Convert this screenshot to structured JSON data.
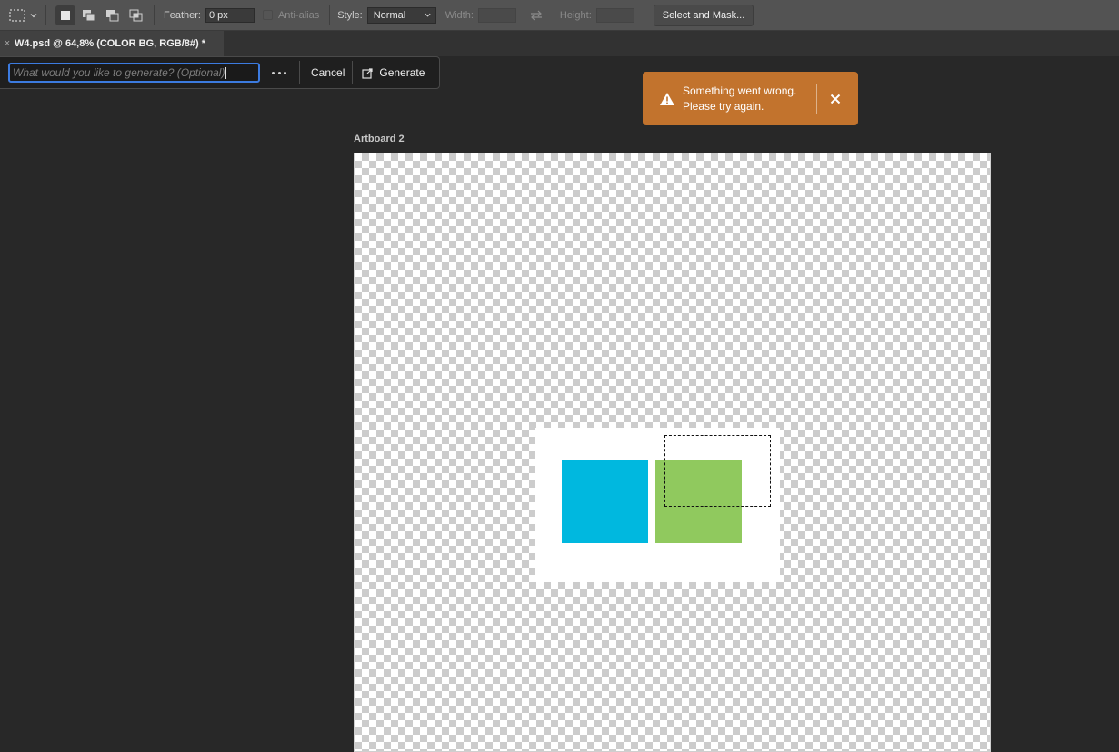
{
  "options_bar": {
    "feather_label": "Feather:",
    "feather_value": "0 px",
    "anti_alias_label": "Anti-alias",
    "style_label": "Style:",
    "style_value": "Normal",
    "width_label": "Width:",
    "height_label": "Height:",
    "select_and_mask_label": "Select and Mask..."
  },
  "document_tab": {
    "close_glyph": "×",
    "title": "W4.psd @ 64,8% (COLOR BG, RGB/8#) *"
  },
  "generate_bar": {
    "prompt_placeholder": "What would you like to generate? (Optional)",
    "cancel_label": "Cancel",
    "generate_label": "Generate"
  },
  "toast": {
    "message_line1": "Something went wrong.",
    "message_line2": "Please try again.",
    "color": "#c2732d"
  },
  "artboard": {
    "title": "Artboard 2",
    "shapes": [
      {
        "name": "blue-square",
        "color": "#00b8df"
      },
      {
        "name": "green-square",
        "color": "#90c95e"
      }
    ]
  }
}
